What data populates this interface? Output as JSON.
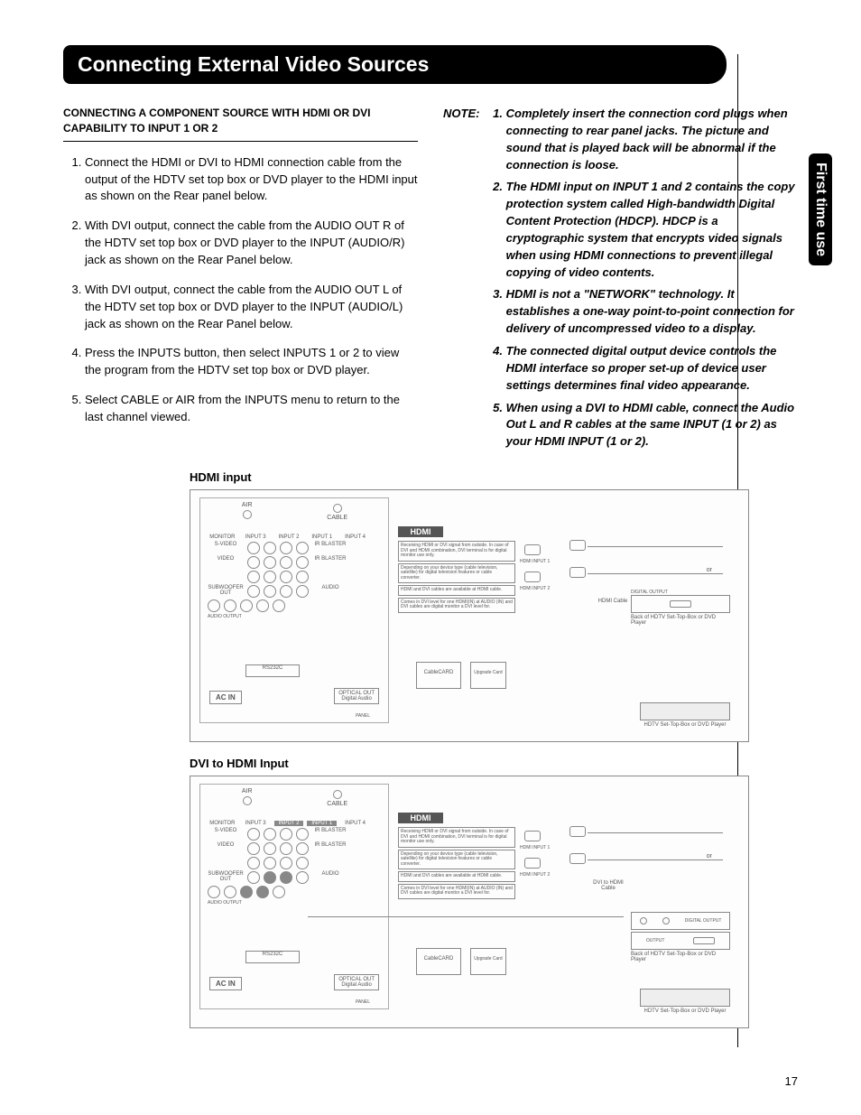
{
  "page": {
    "title": "Connecting External Video Sources",
    "side_tab": "First time use",
    "page_number": "17"
  },
  "section": {
    "heading": "CONNECTING A COMPONENT SOURCE WITH HDMI OR DVI CAPABILITY TO INPUT 1 OR 2"
  },
  "steps": [
    "Connect the HDMI or DVI to HDMI connection cable from the output of the HDTV set top box or DVD player to the HDMI input as shown on the Rear panel below.",
    "With DVI output, connect the cable from the AUDIO OUT R of the HDTV set top box or DVD player to the INPUT (AUDIO/R) jack as shown on the Rear Panel below.",
    "With DVI output, connect the cable from the AUDIO OUT L of the HDTV set top box or DVD player to the INPUT (AUDIO/L) jack as shown on the Rear Panel below.",
    "Press the INPUTS button, then select INPUTS 1 or 2 to view the program from the HDTV set top box or DVD player.",
    "Select CABLE or AIR from the INPUTS menu to return to the last channel viewed."
  ],
  "note": {
    "label": "NOTE:",
    "items": [
      "Completely insert the connection cord plugs when connecting to rear panel jacks. The picture and sound that is played back will be abnormal if the connection is loose.",
      "The HDMI input on INPUT 1 and 2 contains the copy protection system called High-bandwidth Digital Content Protection (HDCP). HDCP is a cryptographic system that encrypts video signals when using HDMI connections to prevent illegal copying of video contents.",
      "HDMI is not a \"NETWORK\" technology. It establishes a one-way point-to-point connection for delivery of uncompressed video to a display.",
      "The connected digital output device controls the HDMI interface so proper set-up of device user settings determines final video appearance.",
      "When using a DVI to HDMI cable, connect the Audio Out L and R cables at the same INPUT (1 or 2) as your HDMI INPUT (1 or 2)."
    ]
  },
  "diagrams": {
    "hdmi_title": "HDMI input",
    "dvi_title": "DVI to HDMI Input",
    "labels": {
      "air": "AIR",
      "cable": "CABLE",
      "ac_in": "AC IN",
      "optical_out": "OPTICAL OUT",
      "optical_sub": "Digital Audio",
      "rs232": "RS232C",
      "hdmi_logo": "HDMI",
      "hdmi_input_1": "HDMI INPUT 1",
      "hdmi_input_2": "HDMI INPUT 2",
      "cablecard": "CableCARD",
      "upgrade": "Upgrade Card",
      "or": "or",
      "hdmi_cable": "HDMI Cable",
      "dvi_cable": "DVI to HDMI Cable",
      "back_of": "Back of HDTV Set-Top-Box or DVD Player",
      "settop": "HDTV Set-Top-Box or DVD Player",
      "digital_output": "DIGITAL OUTPUT",
      "output": "OUTPUT",
      "subwoofer": "SUBWOOFER OUT",
      "audio": "AUDIO",
      "ir_blaster": "IR BLASTER",
      "s_video": "S-VIDEO",
      "video": "VIDEO",
      "monitor": "MONITOR",
      "input1": "INPUT 1",
      "input2": "INPUT 2",
      "input3": "INPUT 3",
      "input4": "INPUT 4",
      "panel": "PANEL",
      "audio_output": "AUDIO OUTPUT"
    }
  }
}
